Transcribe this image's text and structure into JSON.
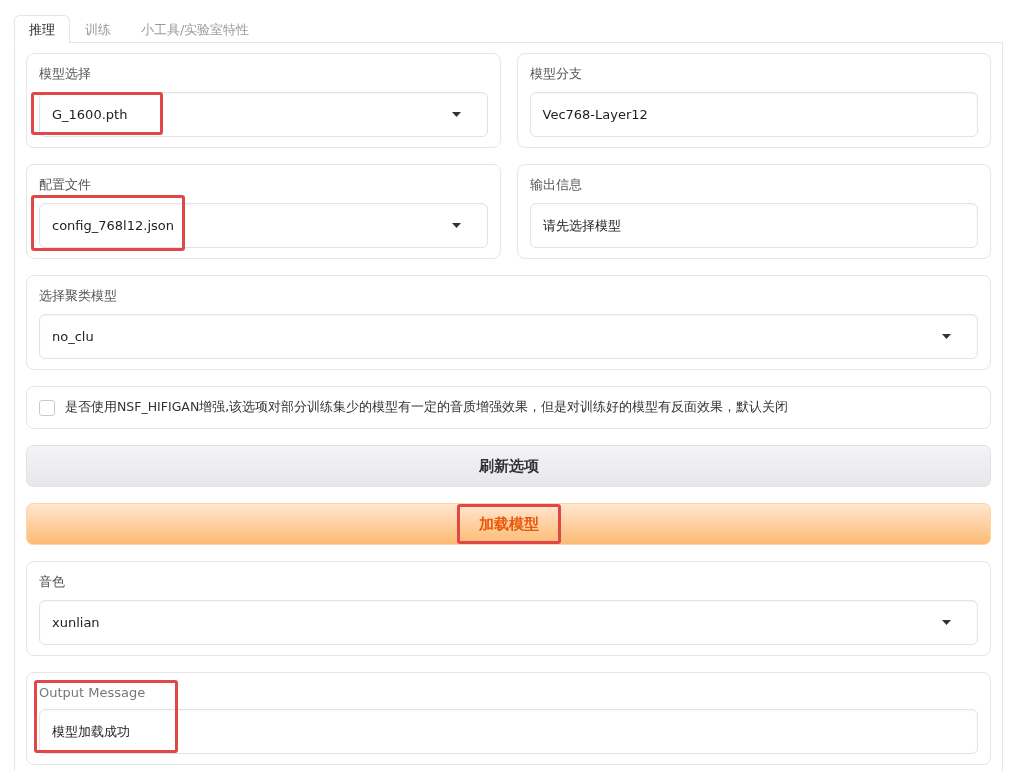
{
  "tabs": [
    {
      "label": "推理",
      "selected": true
    },
    {
      "label": "训练",
      "selected": false
    },
    {
      "label": "小工具/实验室特性",
      "selected": false
    }
  ],
  "row_1": [
    {
      "kind": "dropdown",
      "label": "模型选择",
      "value": "G_1600.pth",
      "highlighted": true
    },
    {
      "kind": "textbox",
      "label": "模型分支",
      "value": "Vec768-Layer12",
      "highlighted": false
    }
  ],
  "row_2": [
    {
      "kind": "dropdown",
      "label": "配置文件",
      "value": "config_768l12.json",
      "highlighted": true
    },
    {
      "kind": "textbox",
      "label": "输出信息",
      "value": "请先选择模型",
      "highlighted": false
    }
  ],
  "cluster_model": {
    "label": "选择聚类模型",
    "value": "no_clu"
  },
  "nsf_option": {
    "label": "是否使用NSF_HIFIGAN增强,该选项对部分训练集少的模型有一定的音质增强效果，但是对训练好的模型有反面效果，默认关闭",
    "checked": false
  },
  "buttons": [
    {
      "kind": "secondary",
      "label": "刷新选项",
      "highlighted": false
    },
    {
      "kind": "primary",
      "label": "加载模型",
      "highlighted": true
    }
  ],
  "voice": {
    "label": "音色",
    "value": "xunlian"
  },
  "output_message": {
    "label": "Output Message",
    "value": "模型加载成功",
    "highlighted": true
  }
}
